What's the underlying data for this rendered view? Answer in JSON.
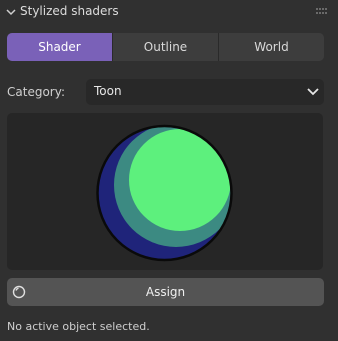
{
  "panel": {
    "title": "Stylized shaders",
    "expanded": true
  },
  "tabs": [
    {
      "label": "Shader",
      "active": true
    },
    {
      "label": "Outline",
      "active": false
    },
    {
      "label": "World",
      "active": false
    }
  ],
  "category": {
    "label": "Category:",
    "value": "Toon"
  },
  "preview": {
    "description": "toon-shaded sphere",
    "colors": {
      "shadow": "#1f247a",
      "midtone": "#3c8a82",
      "highlight": "#5df07d",
      "outline": "#0a0a0a"
    }
  },
  "assign": {
    "label": "Assign",
    "icon": "material-ball-icon"
  },
  "status": {
    "message": "No active object selected."
  },
  "colors": {
    "accent": "#7a61b8",
    "panel_bg": "#303030",
    "button_bg": "#545454",
    "field_bg": "#282828"
  }
}
